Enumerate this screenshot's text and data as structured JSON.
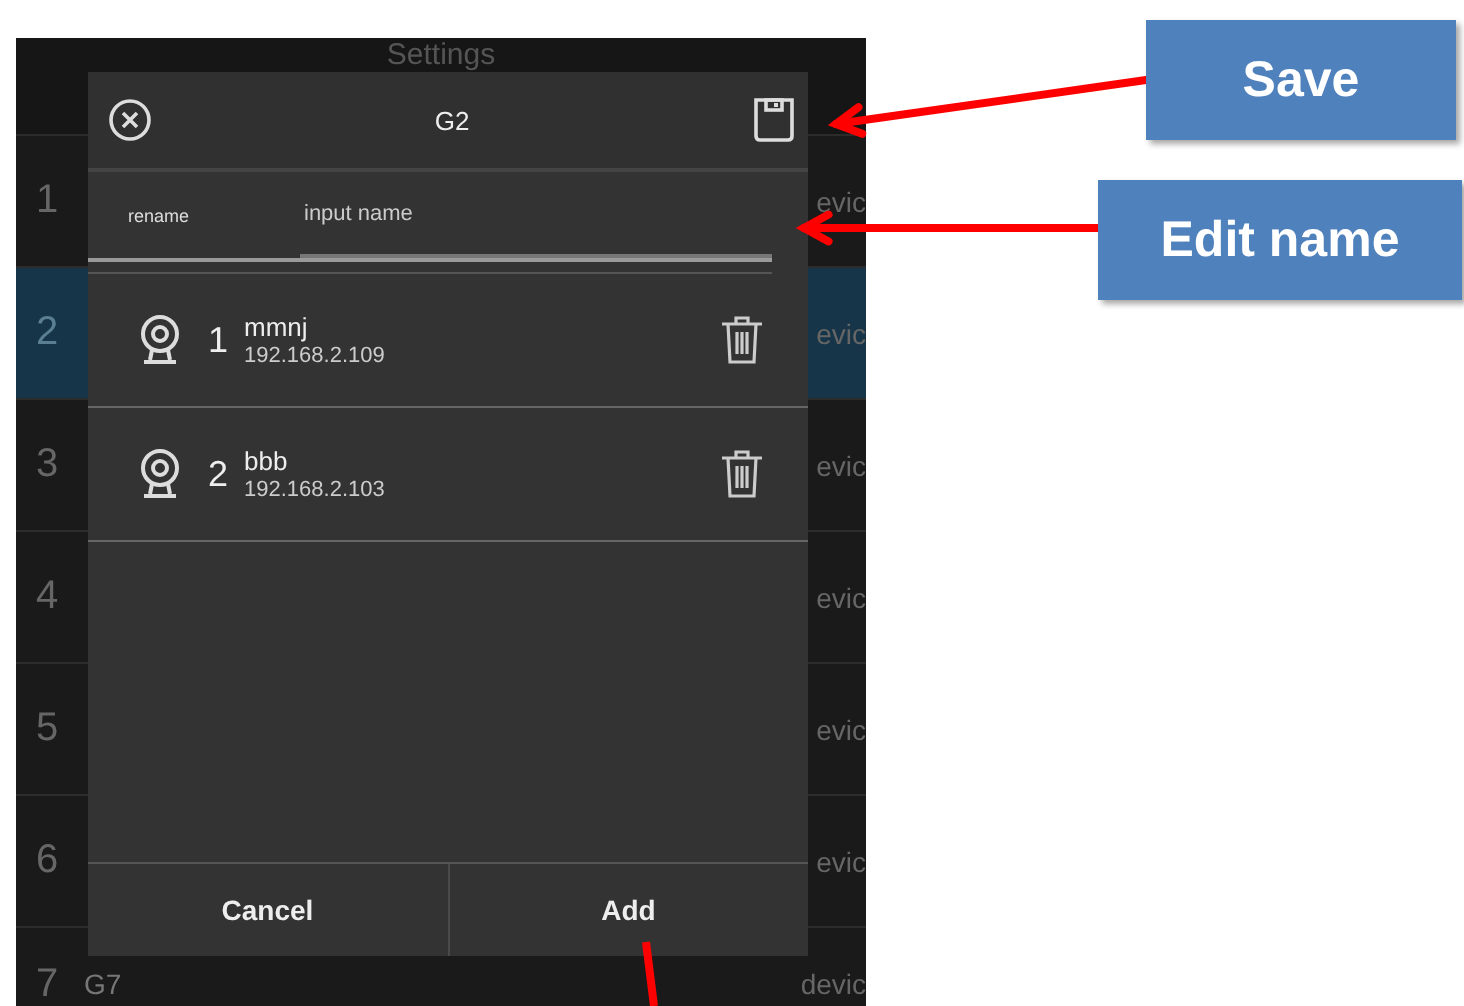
{
  "screen": {
    "title": "Settings",
    "rows": [
      {
        "number": "1",
        "column_3": "evic",
        "selected": false
      },
      {
        "number": "2",
        "column_3": "evic",
        "selected": true
      },
      {
        "number": "3",
        "column_3": "evic",
        "selected": false
      },
      {
        "number": "4",
        "column_3": "evic",
        "selected": false
      },
      {
        "number": "5",
        "column_3": "evic",
        "selected": false
      },
      {
        "number": "6",
        "column_3": "evic",
        "selected": false
      },
      {
        "number": "7",
        "name": "G7",
        "column_3": "devic",
        "selected": false
      }
    ]
  },
  "dialog": {
    "title": "G2",
    "rename": {
      "label": "rename",
      "placeholder": "input name"
    },
    "devices": [
      {
        "index": "1",
        "name": "mmnj",
        "ip": "192.168.2.109"
      },
      {
        "index": "2",
        "name": "bbb",
        "ip": "192.168.2.103"
      }
    ],
    "buttons": [
      "Cancel",
      "Add"
    ]
  },
  "annotations": [
    {
      "kind": "callout",
      "label": "Save"
    },
    {
      "kind": "callout",
      "label": "Edit name"
    },
    {
      "kind": "pointer"
    }
  ]
}
